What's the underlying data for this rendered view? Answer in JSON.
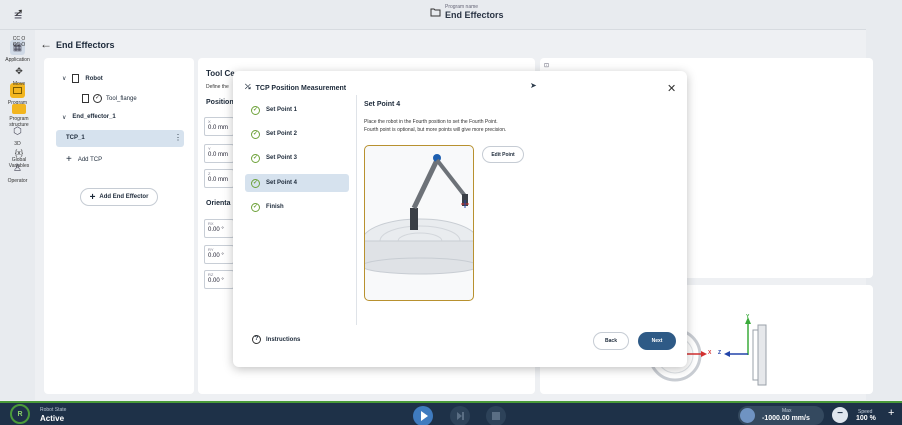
{
  "header": {
    "program_label": "Program name",
    "program_name": "End Effectors"
  },
  "left_nav": [
    {
      "label": "Application"
    },
    {
      "label": "Program"
    },
    {
      "label": "3D"
    },
    {
      "label": "Operator"
    }
  ],
  "right_nav": [
    {
      "label": "CC O"
    },
    {
      "label": "CC O"
    },
    {
      "label": "Move"
    },
    {
      "label": "Program structure"
    },
    {
      "label": "Global Variables"
    }
  ],
  "page": {
    "title": "End Effectors"
  },
  "tree": {
    "robot": "Robot",
    "tool_flange": "Tool_flange",
    "end_effector": "End_effector_1",
    "tcp": "TCP_1",
    "add_tcp": "Add TCP",
    "add_end_effector": "Add End Effector"
  },
  "tool_panel": {
    "title": "Tool Ce",
    "subtitle": "Define the",
    "position_label": "Position",
    "orientation_label": "Orienta",
    "fields": [
      {
        "key": "X",
        "value": "0.0 mm"
      },
      {
        "key": "Y",
        "value": "0.0 mm"
      },
      {
        "key": "Z",
        "value": "0.0 mm"
      },
      {
        "key": "RX",
        "value": "0.00 °"
      },
      {
        "key": "RY",
        "value": "0.00 °"
      },
      {
        "key": "RZ",
        "value": "0.00 °"
      }
    ]
  },
  "view_panel1": {
    "icon_text": "⊡"
  },
  "modal": {
    "title": "TCP Position Measurement",
    "steps": [
      {
        "label": "Set Point 1"
      },
      {
        "label": "Set Point 2"
      },
      {
        "label": "Set Point 3"
      },
      {
        "label": "Set Point 4"
      },
      {
        "label": "Finish"
      }
    ],
    "active_step": 3,
    "step_title": "Set Point 4",
    "desc_line1": "Place the robot in the Fourth position to set the Fourth Point.",
    "desc_line2": "Fourth point is optional, but more points will give more precision.",
    "edit_point": "Edit Point",
    "instructions": "Instructions",
    "back": "Back",
    "next": "Next"
  },
  "bottom": {
    "state_label": "Robot State",
    "state_value": "Active",
    "max_label": "Max",
    "max_value": "-1000.00 mm/s",
    "speed_label": "Speed",
    "speed_value": "100 %"
  },
  "axes": {
    "x": "X",
    "y": "Y",
    "z": "Z"
  },
  "colors": {
    "accent": "#2e5a86",
    "active_green": "#4a9a3a",
    "highlight": "#d6e2ee",
    "robot_frame": "#b8912f"
  }
}
